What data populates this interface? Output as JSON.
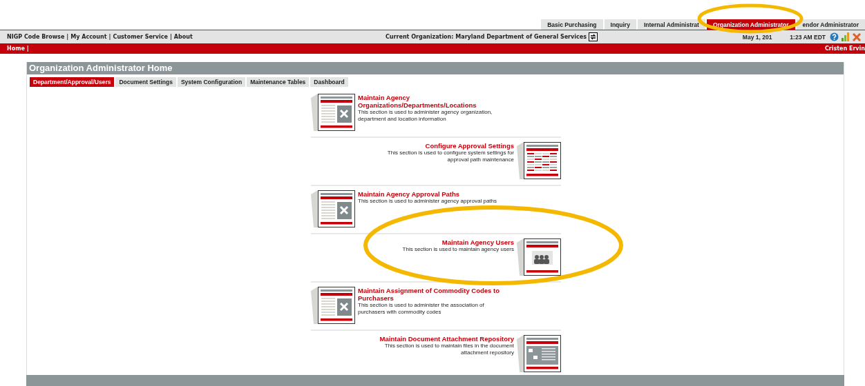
{
  "top_tabs": [
    {
      "label": "Basic Purchasing",
      "selected": false
    },
    {
      "label": "Inquiry",
      "selected": false
    },
    {
      "label": "Internal Administrat",
      "selected": false
    },
    {
      "label": "Organization Administrator",
      "selected": true
    },
    {
      "label": "endor Administrator",
      "selected": false
    }
  ],
  "utility_links": [
    {
      "label": "NIGP Code Browse",
      "separator": "|"
    },
    {
      "label": "My Account",
      "separator": "|"
    },
    {
      "label": "Customer Service",
      "separator": "|"
    },
    {
      "label": "About"
    }
  ],
  "current_organization": "Current Organization: Maryland Department of General Services",
  "date_parts": [
    "May 1, 201",
    "1:23 AM EDT"
  ],
  "breadcrumb": "Home |",
  "user_name": "Cristen Ervin",
  "page_title": "Organization Administrator Home",
  "sub_tabs": [
    {
      "label": "Department/Approval/Users",
      "selected": true
    },
    {
      "label": "Document Settings",
      "selected": false
    },
    {
      "label": "System Configuration",
      "selected": false
    },
    {
      "label": "Maintenance Tables",
      "selected": false
    },
    {
      "label": "Dashboard",
      "selected": false
    }
  ],
  "sections": [
    {
      "title": "Maintain Agency Organizations/Departments/Locations",
      "description": "This section is used to administer agency organization, department and location information",
      "image_right": false,
      "kind": "tools"
    },
    {
      "title": "Configure Approval Settings",
      "description": "This section is used to configure system settings for approval path maintenance",
      "image_right": true,
      "kind": "grid"
    },
    {
      "title": "Maintain Agency Approval Paths",
      "description": "This section is used to administer agency approval paths",
      "image_right": false,
      "kind": "tools"
    },
    {
      "title": "Maintain Agency Users",
      "description": "This section is used to maintain agency users",
      "image_right": true,
      "kind": "users"
    },
    {
      "title": "Maintain Assignment of Commodity Codes to Purchasers",
      "description": "This section is used to administer the association of purchasers with commodity codes",
      "image_right": false,
      "kind": "tools"
    },
    {
      "title": "Maintain Document Attachment Repository",
      "description": "This section is used to maintain files in the document attachment repository",
      "image_right": true,
      "kind": "files"
    }
  ]
}
